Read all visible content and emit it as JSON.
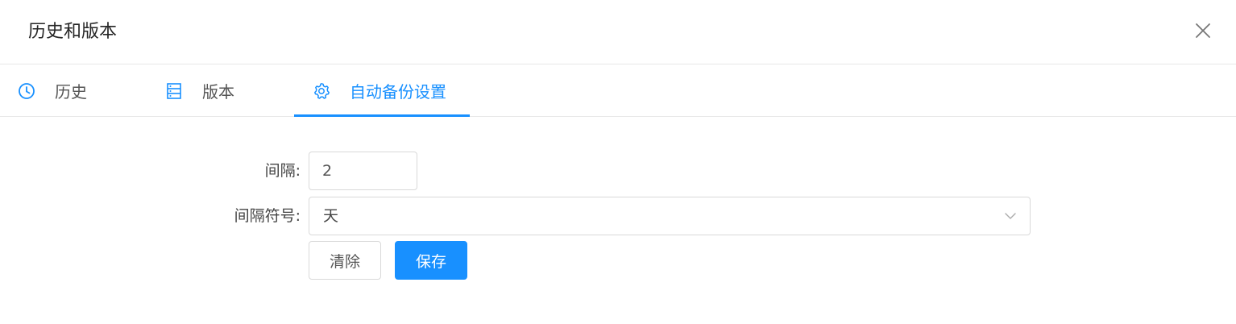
{
  "dialog": {
    "title": "历史和版本",
    "close_icon": "close-icon"
  },
  "tabs": [
    {
      "label": "历史",
      "icon": "clock-icon",
      "active": false
    },
    {
      "label": "版本",
      "icon": "server-stack-icon",
      "active": false
    },
    {
      "label": "自动备份设置",
      "icon": "gear-icon",
      "active": true
    }
  ],
  "form": {
    "interval_label": "间隔:",
    "interval_value": "2",
    "unit_label": "间隔符号:",
    "unit_value": "天",
    "unit_dropdown_icon": "chevron-down-icon"
  },
  "buttons": {
    "clear_label": "清除",
    "save_label": "保存"
  },
  "colors": {
    "accent": "#1890ff",
    "border": "#d9d9d9",
    "divider": "#e8e8e8"
  }
}
